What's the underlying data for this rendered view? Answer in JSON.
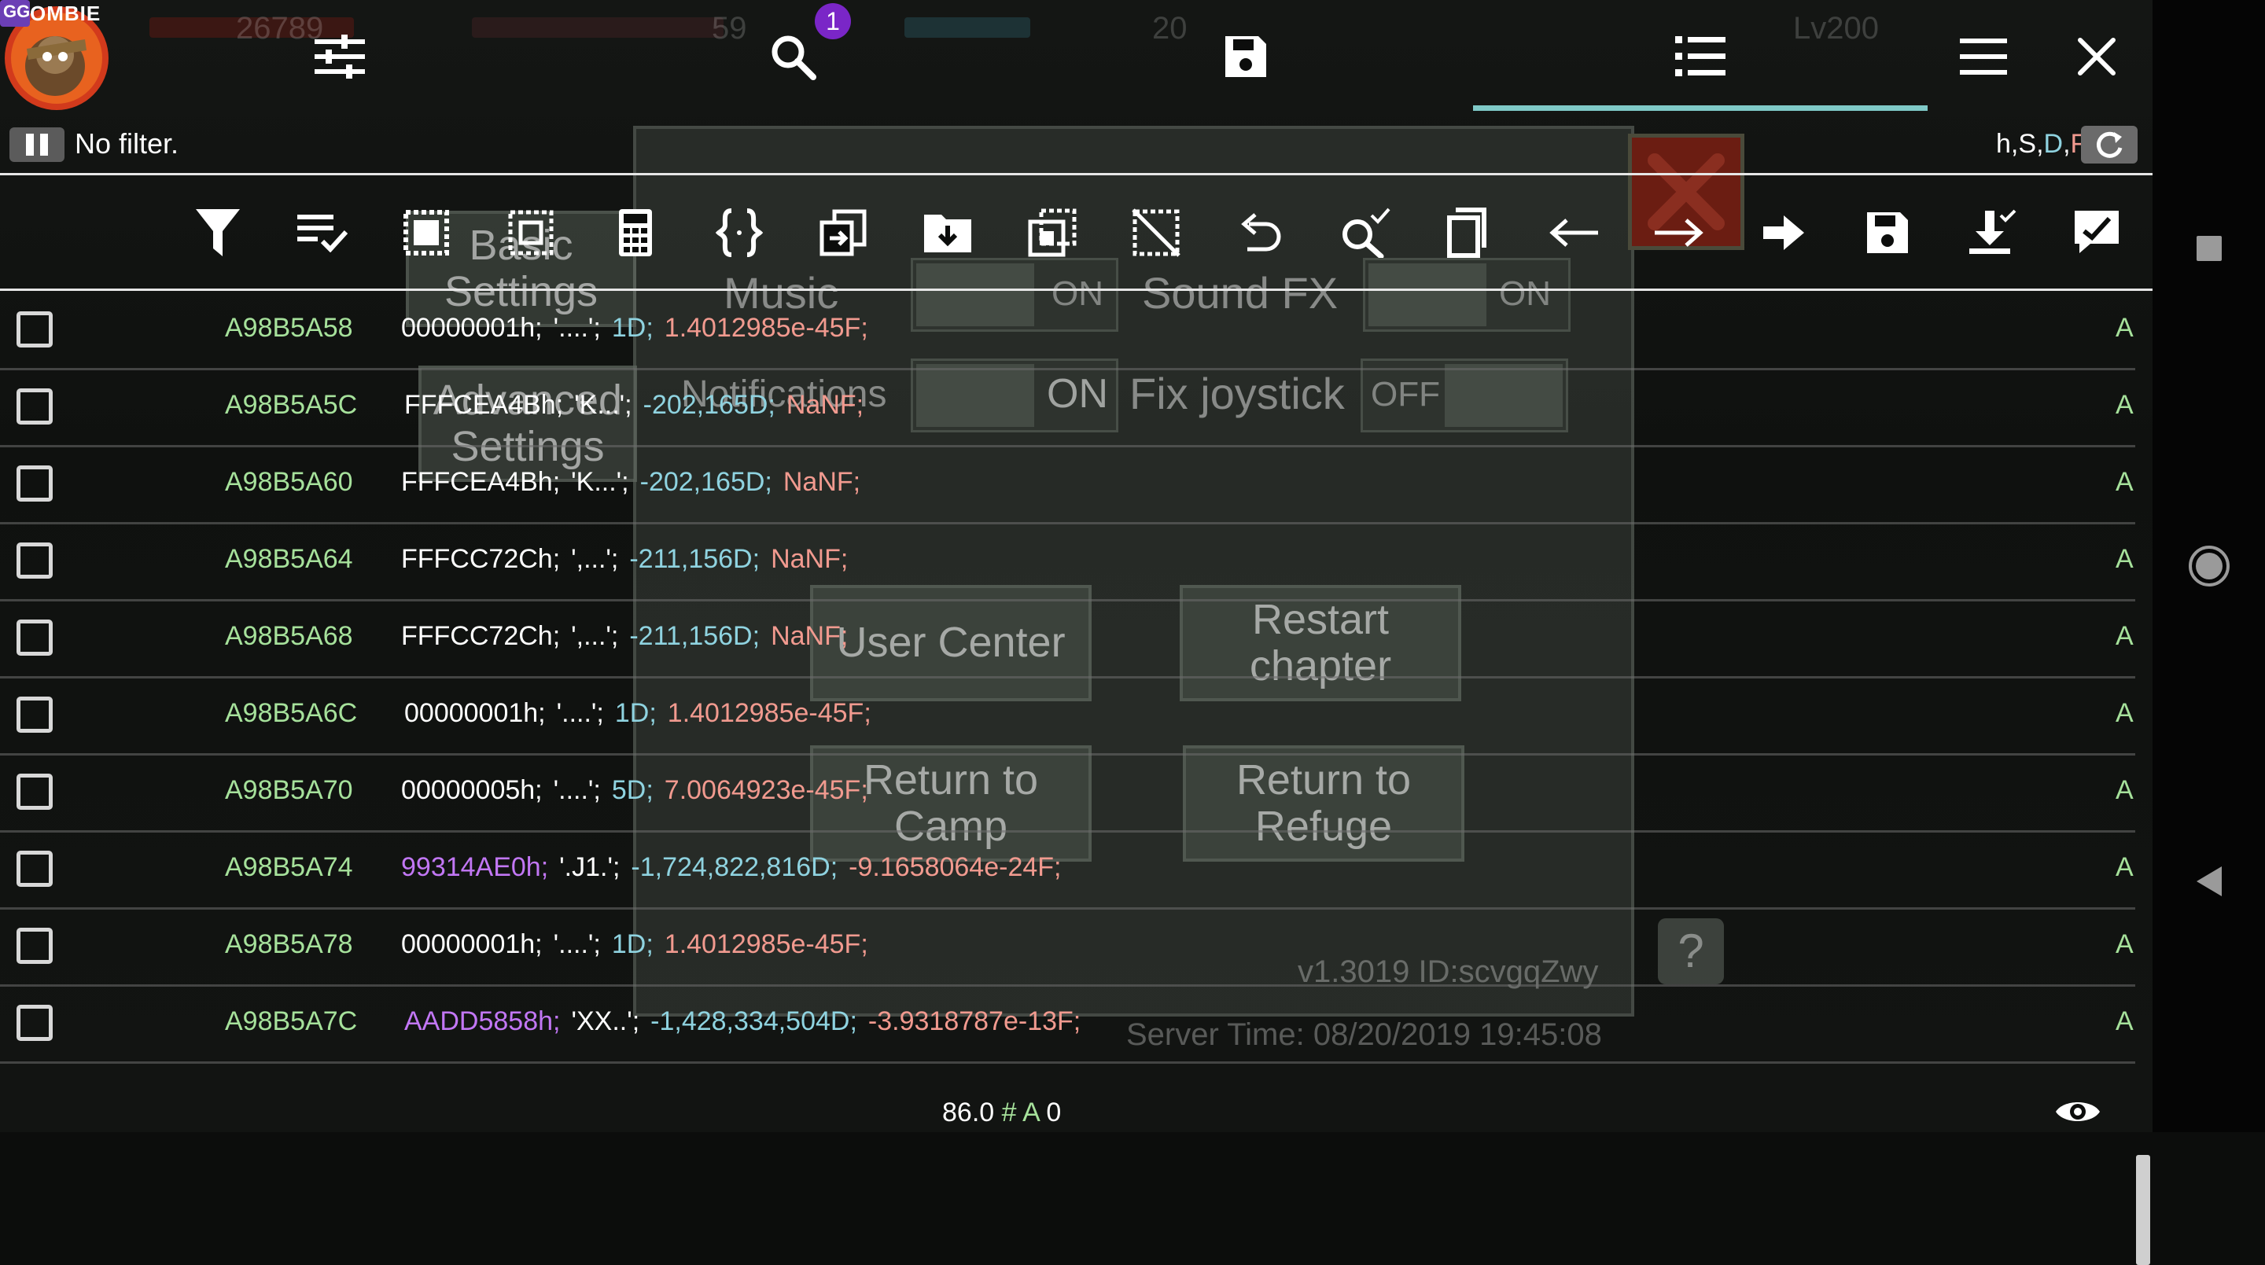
{
  "background_game": {
    "hud_numbers": [
      "26789",
      "59",
      "20"
    ],
    "level": "Lv200",
    "menu": {
      "sidebar_tabs": [
        {
          "label": "Basic Settings"
        },
        {
          "label": "Advanced Settings"
        }
      ],
      "labels": {
        "music": "Music",
        "sound_fx": "Sound FX",
        "notifications": "Notifications",
        "fix_joystick": "Fix joystick"
      },
      "toggles": {
        "music": "ON",
        "sound_fx": "ON",
        "notifications": "ON",
        "fix_joystick": "OFF"
      },
      "buttons": {
        "user_center": "User Center",
        "restart_chapter": "Restart chapter",
        "return_to_camp": "Return to Camp",
        "return_to_refuge": "Return to Refuge"
      },
      "help": "?",
      "version": "v1.3019  ID:scvgqZwy",
      "server_time": "Server Time: 08/20/2019 19:45:08"
    }
  },
  "app": {
    "logo_text": "GG",
    "logo_banner": "OMBIE",
    "topbar": {
      "icons": [
        "sliders-icon",
        "search-icon",
        "save-icon",
        "list-icon",
        "menu-icon",
        "close-icon"
      ],
      "search_badge": "1",
      "active_tab": "list"
    },
    "status": {
      "filter_text": "No filter.",
      "types": {
        "h": "h",
        "s": "S",
        "d": "D",
        "f": "F",
        "sep": ","
      }
    },
    "toolbar_icons": [
      "filter-icon",
      "select-list-icon",
      "select-all-icon",
      "select-region-icon",
      "calculator-icon",
      "braces-icon",
      "copy-to-icon",
      "folder-download-icon",
      "copy-region-icon",
      "deselect-icon",
      "undo-icon",
      "search-check-icon",
      "copy-icon",
      "arrow-left-icon",
      "arrow-right-icon",
      "arrow-bold-right-icon",
      "save-icon",
      "download-all-icon",
      "edit-check-icon"
    ],
    "results": [
      {
        "address": "A98B5A58",
        "hex": "00000001h;",
        "hex_alt": false,
        "str": "'....';",
        "dword": "1D;",
        "float": "1.4012985e-45F;",
        "tail": "A"
      },
      {
        "address": "A98B5A5C",
        "hex": "FFFCEA4Bh;",
        "hex_alt": false,
        "str": "'K...';",
        "dword": "-202,165D;",
        "float": "NaNF;",
        "tail": "A"
      },
      {
        "address": "A98B5A60",
        "hex": "FFFCEA4Bh;",
        "hex_alt": false,
        "str": "'K...';",
        "dword": "-202,165D;",
        "float": "NaNF;",
        "tail": "A"
      },
      {
        "address": "A98B5A64",
        "hex": "FFFCC72Ch;",
        "hex_alt": false,
        "str": "',...';",
        "dword": "-211,156D;",
        "float": "NaNF;",
        "tail": "A"
      },
      {
        "address": "A98B5A68",
        "hex": "FFFCC72Ch;",
        "hex_alt": false,
        "str": "',...';",
        "dword": "-211,156D;",
        "float": "NaNF;",
        "tail": "A"
      },
      {
        "address": "A98B5A6C",
        "hex": "00000001h;",
        "hex_alt": false,
        "str": "'....';",
        "dword": "1D;",
        "float": "1.4012985e-45F;",
        "tail": "A"
      },
      {
        "address": "A98B5A70",
        "hex": "00000005h;",
        "hex_alt": false,
        "str": "'....';",
        "dword": "5D;",
        "float": "7.0064923e-45F;",
        "tail": "A"
      },
      {
        "address": "A98B5A74",
        "hex": "99314AE0h;",
        "hex_alt": true,
        "str": "'.J1.';",
        "dword": "-1,724,822,816D;",
        "float": "-9.1658064e-24F;",
        "tail": "A"
      },
      {
        "address": "A98B5A78",
        "hex": "00000001h;",
        "hex_alt": false,
        "str": "'....';",
        "dword": "1D;",
        "float": "1.4012985e-45F;",
        "tail": "A"
      },
      {
        "address": "A98B5A7C",
        "hex": "AADD5858h;",
        "hex_alt": true,
        "str": "'XX..';",
        "dword": "-1,428,334,504D;",
        "float": "-3.9318787e-13F;",
        "tail": "A"
      }
    ],
    "footer": {
      "value": "86.0",
      "hash": "#",
      "a": "A",
      "count": "0"
    }
  },
  "colors": {
    "address": "#a6e19b",
    "dword": "#8fd3e0",
    "float": "#f19a8f",
    "hex_alt": "#c277f5",
    "accent": "#7fc9c7",
    "badge": "#7a26c7"
  }
}
